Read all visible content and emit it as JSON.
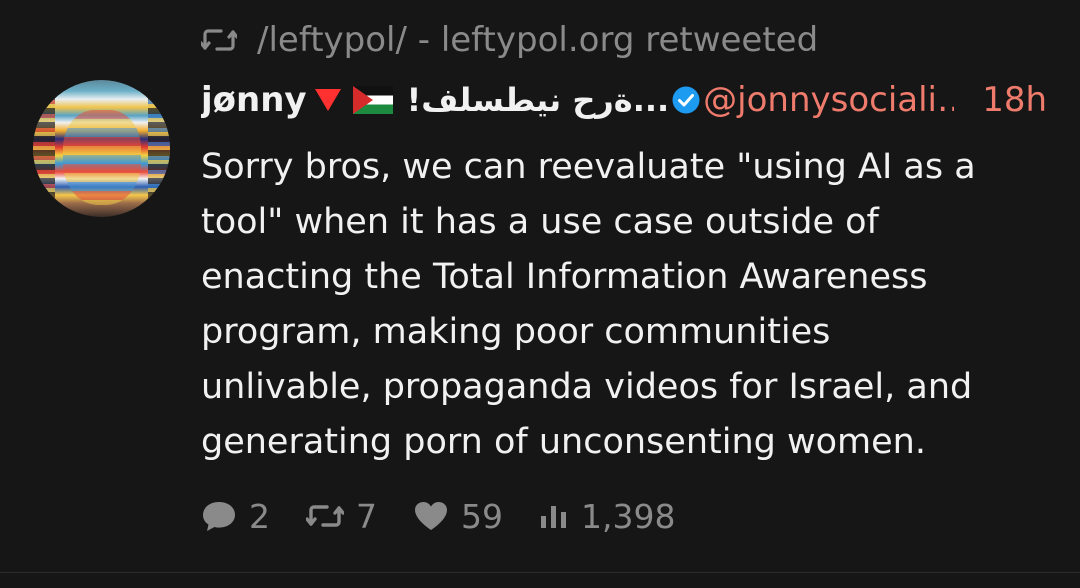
{
  "retweet": {
    "icon": "retweet-icon",
    "text": "/leftypol/ - leftypol.org retweeted"
  },
  "author": {
    "display_name": "jønny",
    "emoji_triangle": "red-triangle-icon",
    "emoji_flag": "palestine-flag-icon",
    "arabic_name": "!فلسطين حرة...",
    "verified_icon": "verified-badge-icon",
    "handle": "@jonnysociali…",
    "avatar": "avatar"
  },
  "tweet": {
    "time": "18h",
    "text": "Sorry bros, we can reevaluate \"using AI as a\ntool\" when it has a use case outside of\nenacting the Total Information Awareness\nprogram, making poor communities\nunlivable, propaganda videos for Israel, and\ngenerating porn of unconsenting women."
  },
  "actions": {
    "replies": "2",
    "retweets": "7",
    "likes": "59",
    "views": "1,398",
    "reply_icon": "reply-icon",
    "retweet_icon": "retweet-icon",
    "like_icon": "heart-icon",
    "views_icon": "views-icon"
  },
  "colors": {
    "background": "#161616",
    "text": "#f1f1f1",
    "muted": "#8a8a8a",
    "accent": "#ef7b6c",
    "verified": "#1d9bf0"
  }
}
